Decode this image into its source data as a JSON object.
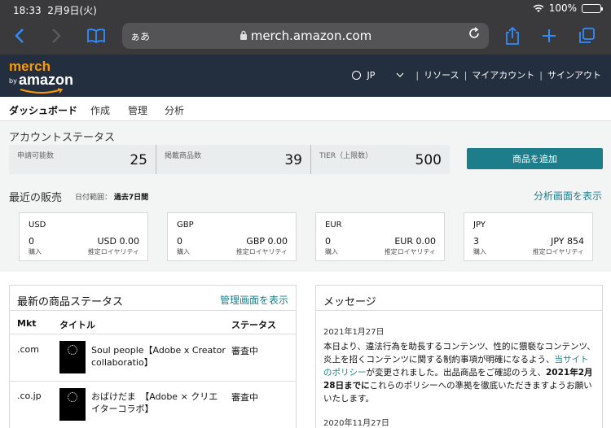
{
  "status_bar": {
    "time": "18:33",
    "date": "2月9日(火)",
    "battery": "100%",
    "battery_level": 1.0
  },
  "browser": {
    "text_size": "ぁあ",
    "url": "merch.amazon.com"
  },
  "header": {
    "logo_top": "merch",
    "logo_by": "by",
    "logo_bottom": "amazon",
    "locale": "JP",
    "nav": [
      "リソース",
      "マイアカウント",
      "サインアウト"
    ]
  },
  "tabs": [
    "ダッシュボード",
    "作成",
    "管理",
    "分析"
  ],
  "account_status": {
    "title": "アカウントステータス",
    "stats": [
      {
        "label": "申請可能数",
        "value": "25"
      },
      {
        "label": "掲載商品数",
        "value": "39"
      },
      {
        "label": "TIER（上限数）",
        "value": "500"
      }
    ],
    "add_button": "商品を追加"
  },
  "recent_sales": {
    "title": "最近の販売",
    "range_label": "日付範囲：",
    "range_value": "過去7日間",
    "analysis_link": "分析画面を表示",
    "cards": [
      {
        "currency": "USD",
        "count": "0",
        "amount": "USD 0.00",
        "count_label": "購入",
        "amount_label": "推定ロイヤリティ"
      },
      {
        "currency": "GBP",
        "count": "0",
        "amount": "GBP 0.00",
        "count_label": "購入",
        "amount_label": "推定ロイヤリティ"
      },
      {
        "currency": "EUR",
        "count": "0",
        "amount": "EUR 0.00",
        "count_label": "購入",
        "amount_label": "推定ロイヤリティ"
      },
      {
        "currency": "JPY",
        "count": "3",
        "amount": "JPY 854",
        "count_label": "購入",
        "amount_label": "推定ロイヤリティ"
      }
    ]
  },
  "product_status": {
    "title": "最新の商品ステータス",
    "manage_link": "管理画面を表示",
    "columns": [
      "Mkt",
      "タイトル",
      "ステータス"
    ],
    "rows": [
      {
        "mkt": ".com",
        "title_line1": "Soul people【Adobe x Creator",
        "title_line2": "collaboratio】",
        "status": "審査中"
      },
      {
        "mkt": ".co.jp",
        "title_line1": "おばけだま　【Adobe × クリエ",
        "title_line2": "イターコラボ】",
        "status": "審査中"
      }
    ]
  },
  "messages": {
    "title": "メッセージ",
    "items": [
      {
        "date": "2021年1月27日",
        "text_before": "本日より、違法行為を助長するコンテンツ、性的に猥褻なコンテンツ、炎上を招くコンテンツに関する制約事項が明確になるよう、",
        "link": "当サイトのポリシー",
        "text_after": "が変更されました。出品商品をご確認のうえ、",
        "bold": "2021年2月28日までに",
        "text_end": "これらのポリシーへの準拠を徹底いただきますようお願いいたします。"
      },
      {
        "date": "2020年11月27日"
      }
    ]
  }
}
